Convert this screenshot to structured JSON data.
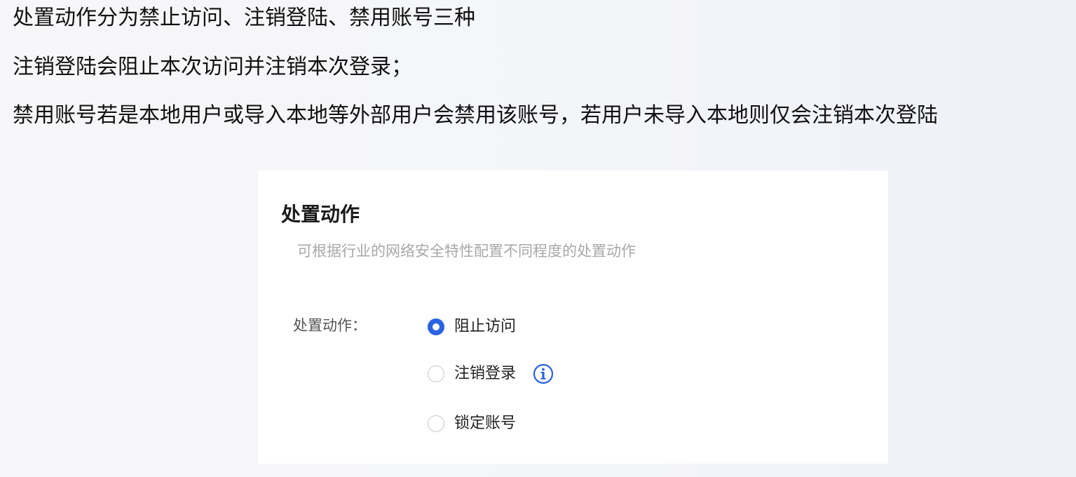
{
  "intro": {
    "line1": "处置动作分为禁止访问、注销登陆、禁用账号三种",
    "line2": "注销登陆会阻止本次访问并注销本次登录；",
    "line3": "禁用账号若是本地用户或导入本地等外部用户会禁用该账号，若用户未导入本地则仅会注销本次登陆"
  },
  "panel": {
    "title": "处置动作",
    "subtitle": "可根据行业的网络安全特性配置不同程度的处置动作",
    "field_label": "处置动作：",
    "options": [
      {
        "label": "阻止访问",
        "checked": true
      },
      {
        "label": "注销登录",
        "checked": false,
        "info_icon": "info-circle-icon"
      },
      {
        "label": "锁定账号",
        "checked": false
      }
    ]
  },
  "colors": {
    "accent": "#2b63e0",
    "text": "#111111",
    "muted": "#a8a8a8",
    "panel_bg": "#ffffff"
  }
}
